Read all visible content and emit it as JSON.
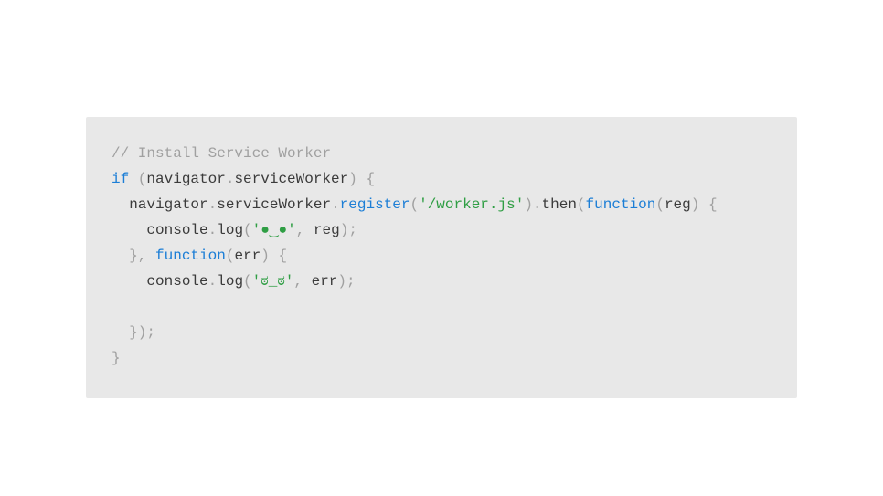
{
  "code": {
    "line1": {
      "comment": "// Install Service Worker"
    },
    "line2": {
      "indent": "",
      "kw_if": "if",
      "p1": " (",
      "navigator": "navigator",
      "dot1": ".",
      "sw": "serviceWorker",
      "p2": ") {"
    },
    "line3": {
      "indent": "  ",
      "navigator": "navigator",
      "dot1": ".",
      "sw": "serviceWorker",
      "dot2": ".",
      "register": "register",
      "p1": "(",
      "string1": "'/worker.js'",
      "p2": ").",
      "then": "then",
      "p3": "(",
      "kw_function": "function",
      "p4": "(",
      "reg": "reg",
      "p5": ") {"
    },
    "line4": {
      "indent": "    ",
      "console": "console",
      "dot": ".",
      "log": "log",
      "p1": "(",
      "string1": "'●‿●'",
      "comma": ", ",
      "reg": "reg",
      "p2": ");"
    },
    "line5": {
      "indent": "  ",
      "p1": "}, ",
      "kw_function": "function",
      "p2": "(",
      "err": "err",
      "p3": ") {"
    },
    "line6": {
      "indent": "    ",
      "console": "console",
      "dot": ".",
      "log": "log",
      "p1": "(",
      "string1": "'ಠ_ಠ'",
      "comma": ", ",
      "err": "err",
      "p2": ");"
    },
    "line7": {
      "indent": "  ",
      "p1": "});"
    },
    "line8": {
      "p1": "}"
    }
  }
}
